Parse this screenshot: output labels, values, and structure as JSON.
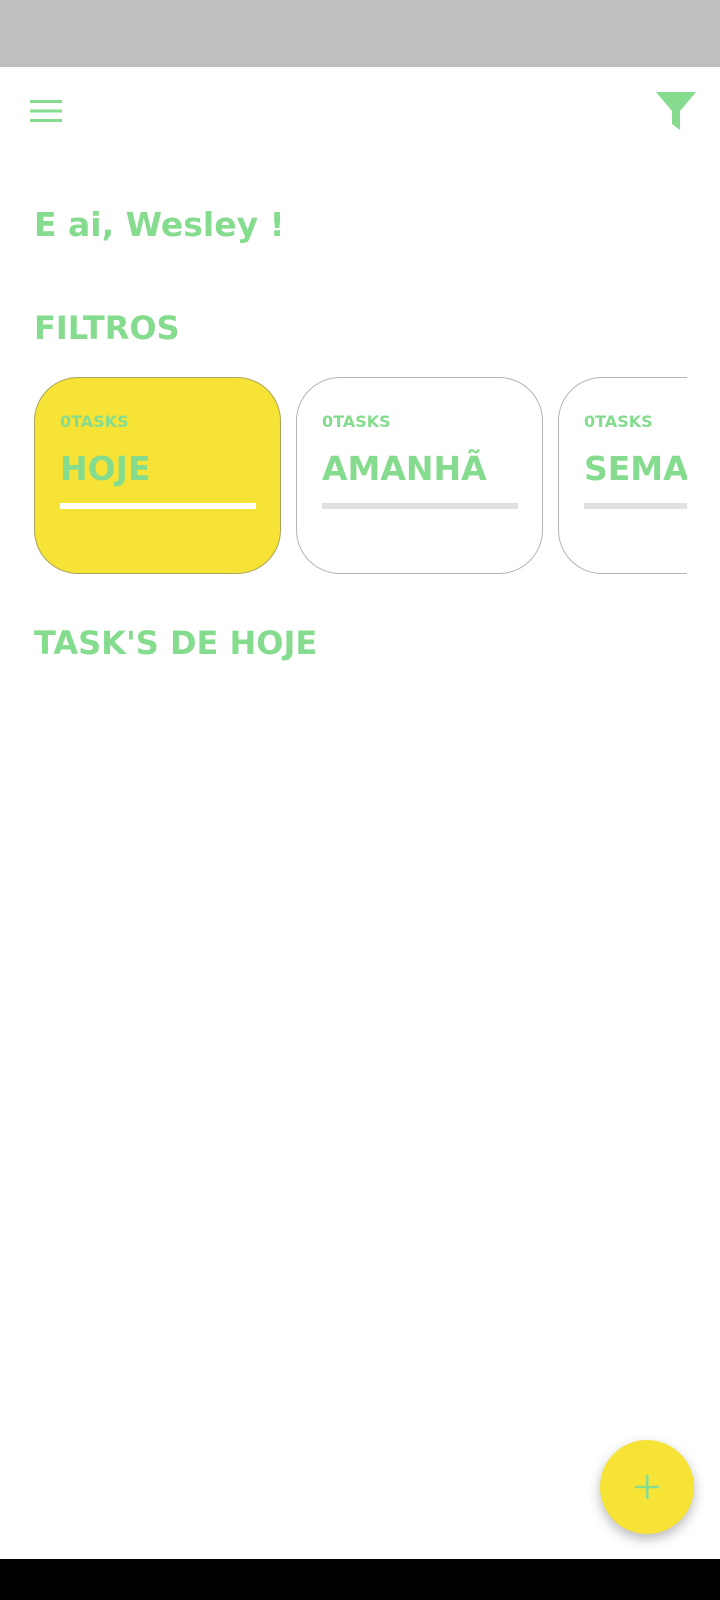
{
  "colors": {
    "accent_green": "#86dc8e",
    "accent_yellow": "#f6e335",
    "status_bar": "#bfbfbf",
    "nav_bar": "#000000"
  },
  "app_bar": {
    "menu_icon": "hamburger-menu-icon",
    "filter_icon": "funnel-filter-icon"
  },
  "greeting": "E ai, Wesley !",
  "filters_title": "FILTROS",
  "filters": [
    {
      "count": "0TASKS",
      "label": "HOJE",
      "selected": true
    },
    {
      "count": "0TASKS",
      "label": "AMANHÃ",
      "selected": false
    },
    {
      "count": "0TASKS",
      "label": "SEMA",
      "selected": false
    }
  ],
  "tasks_title": "TASK'S DE HOJE",
  "fab": {
    "icon": "plus-icon"
  }
}
